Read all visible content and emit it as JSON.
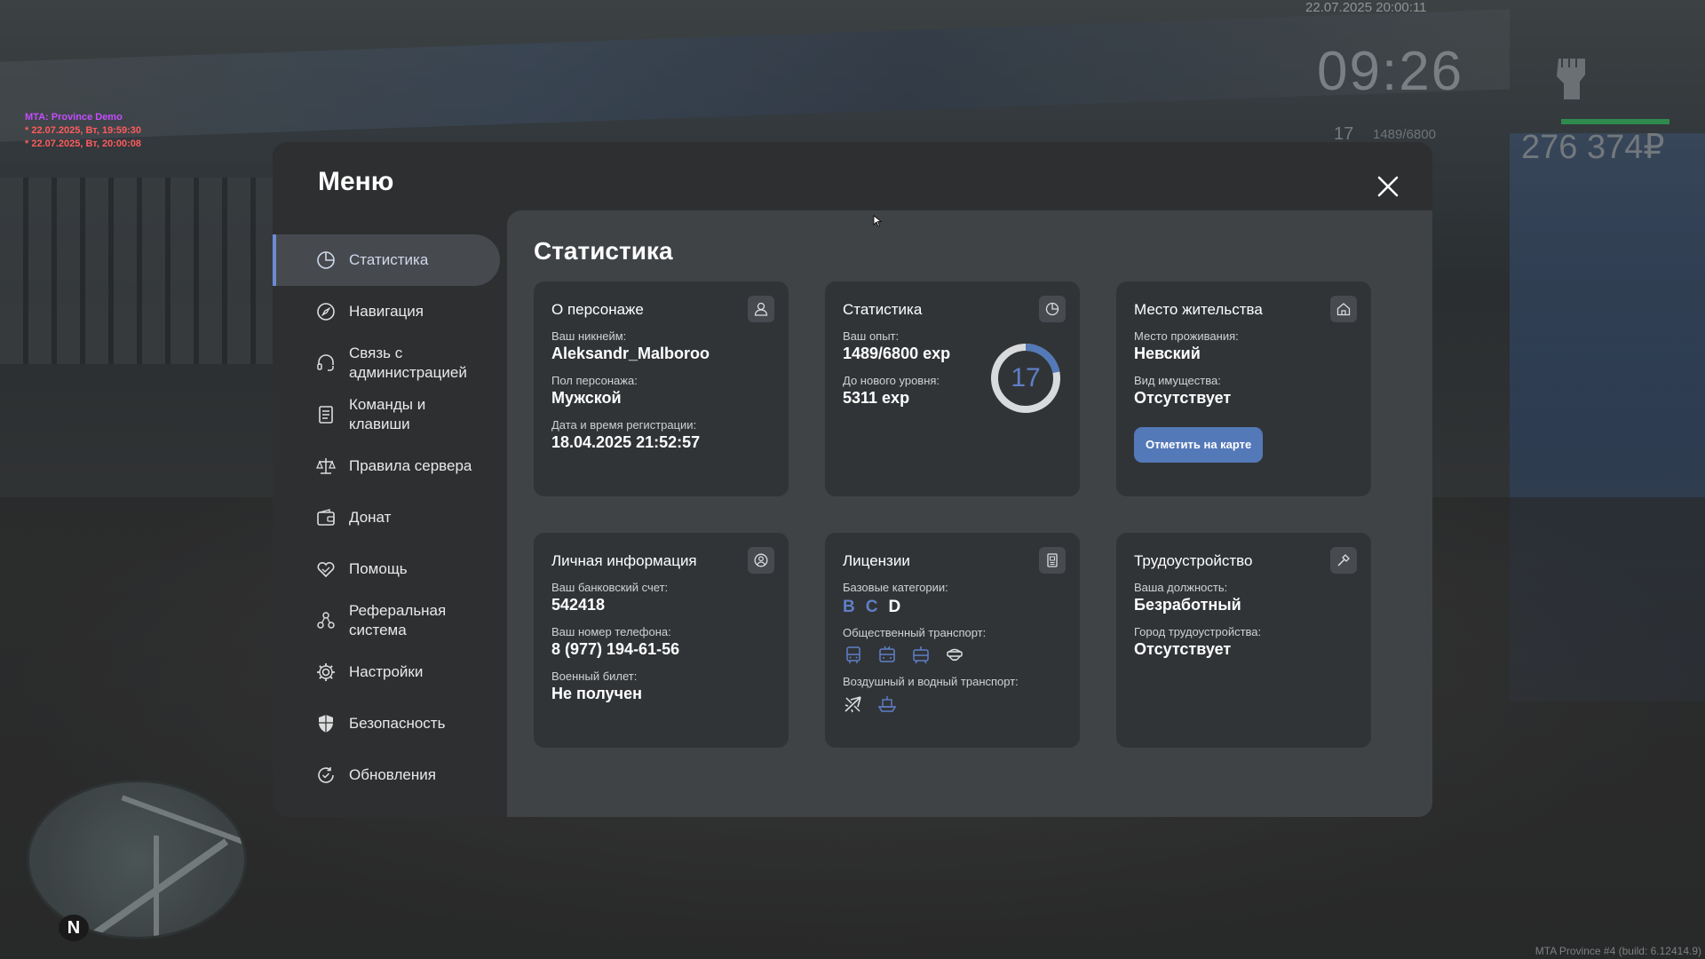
{
  "hud": {
    "debug_title": "MTA: Province Demo",
    "debug_lines": [
      "* 22.07.2025, Вт, 19:59:30",
      "* 22.07.2025, Вт, 20:00:08"
    ],
    "date": "22.07.2025 20:00:11",
    "time": "09:26",
    "level": "17",
    "exp": "1489/6800",
    "money": "276 374₽",
    "build": "MTA Province #4 (build: 6.12414.9)",
    "minimap_north": "N"
  },
  "menu": {
    "title": "Меню",
    "sidebar": [
      {
        "label": "Статистика",
        "icon": "pie-chart-icon",
        "active": true
      },
      {
        "label": "Навигация",
        "icon": "compass-icon"
      },
      {
        "label": "Связь с администрацией",
        "icon": "headset-icon"
      },
      {
        "label": "Команды и клавиши",
        "icon": "document-list-icon"
      },
      {
        "label": "Правила сервера",
        "icon": "scales-icon"
      },
      {
        "label": "Донат",
        "icon": "wallet-icon"
      },
      {
        "label": "Помощь",
        "icon": "heart-hand-icon"
      },
      {
        "label": "Реферальная система",
        "icon": "referral-icon"
      },
      {
        "label": "Настройки",
        "icon": "gear-icon"
      },
      {
        "label": "Безопасность",
        "icon": "shield-icon"
      },
      {
        "label": "Обновления",
        "icon": "refresh-check-icon"
      }
    ]
  },
  "content": {
    "title": "Статистика",
    "character": {
      "title": "О персонаже",
      "icon": "user-icon",
      "nickname_label": "Ваш никнейм:",
      "nickname": "Aleksandr_Malboroo",
      "gender_label": "Пол персонажа:",
      "gender": "Мужской",
      "reg_label": "Дата и время регистрации:",
      "reg": "18.04.2025 21:52:57"
    },
    "stats": {
      "title": "Статистика",
      "icon": "pie-chart-icon",
      "exp_label": "Ваш опыт:",
      "exp": "1489/6800 exp",
      "next_label": "До нового уровня:",
      "next": "5311 exp",
      "level": "17",
      "progress": 0.219
    },
    "residence": {
      "title": "Место жительства",
      "icon": "home-icon",
      "place_label": "Место проживания:",
      "place": "Невский",
      "property_label": "Вид имущества:",
      "property": "Отсутствует",
      "button": "Отметить на карте"
    },
    "personal": {
      "title": "Личная информация",
      "icon": "user-circle-icon",
      "bank_label": "Ваш банковский счет:",
      "bank": "542418",
      "phone_label": "Ваш номер телефона:",
      "phone": "8 (977) 194-61-56",
      "military_label": "Военный билет:",
      "military": "Не получен"
    },
    "licenses": {
      "title": "Лицензии",
      "icon": "id-card-icon",
      "base_label": "Базовые категории:",
      "categories": [
        {
          "letter": "B",
          "state": "has"
        },
        {
          "letter": "C",
          "state": "has"
        },
        {
          "letter": "D",
          "state": "owned"
        }
      ],
      "public_label": "Общественный транспорт:",
      "public_icons": [
        "bus-icon",
        "trolleybus-icon",
        "tram-icon",
        "taxi-icon"
      ],
      "air_label": "Воздушный и водный транспорт:",
      "air_icons": [
        "plane-icon",
        "boat-icon"
      ]
    },
    "job": {
      "title": "Трудоустройство",
      "icon": "hammer-icon",
      "position_label": "Ваша должность:",
      "position": "Безработный",
      "city_label": "Город трудоустройства:",
      "city": "Отсутствует"
    }
  },
  "colors": {
    "accent": "#5479b8",
    "category_has": "#5f7fc7",
    "panel": "#2d2f31",
    "content": "#404346",
    "card": "#313437"
  }
}
